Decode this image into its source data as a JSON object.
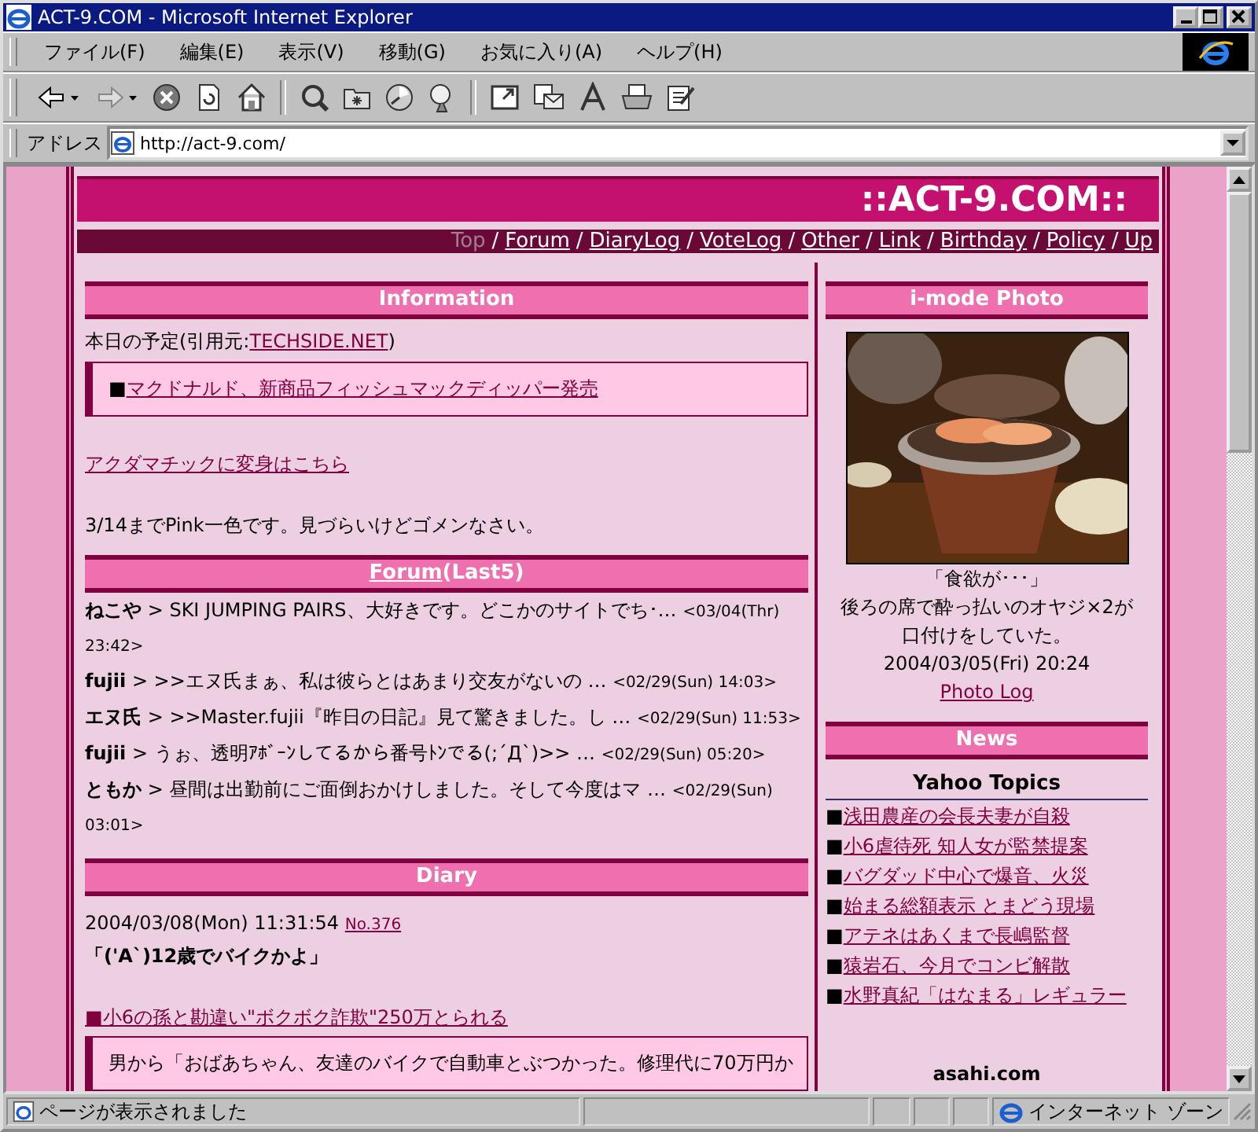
{
  "window": {
    "title": "ACT-9.COM - Microsoft Internet Explorer"
  },
  "menu": [
    "ファイル(F)",
    "編集(E)",
    "表示(V)",
    "移動(G)",
    "お気に入り(A)",
    "ヘルプ(H)"
  ],
  "address": {
    "label": "アドレス",
    "value": "http://act-9.com/"
  },
  "site": {
    "title": "::ACT-9.COM::",
    "nav_separator": "/",
    "nav": [
      {
        "label": "Top",
        "selected": true
      },
      {
        "label": "Forum",
        "selected": false
      },
      {
        "label": "DiaryLog",
        "selected": false
      },
      {
        "label": "VoteLog",
        "selected": false
      },
      {
        "label": "Other",
        "selected": false
      },
      {
        "label": "Link",
        "selected": false
      },
      {
        "label": "Birthday",
        "selected": false
      },
      {
        "label": "Policy",
        "selected": false
      },
      {
        "label": "Up",
        "selected": false
      }
    ],
    "information": {
      "heading": "Information",
      "source_prefix": "本日の予定(引用元:",
      "source_link": "TECHSIDE.NET",
      "source_suffix": ")",
      "headline_mark": "■",
      "headline": "マクドナルド、新商品フィッシュマックディッパー発売",
      "transform_link": "アクダマチックに変身はこちら",
      "notice": "3/14までPink一色です。見づらいけどゴメンなさい。"
    },
    "forum": {
      "heading_link": "Forum",
      "heading_rest": "(Last5)",
      "posts": [
        {
          "name": "ねこや",
          "text": "> SKI JUMPING PAIRS、大好きです。どこかのサイトでち･…",
          "date": "<03/04(Thr) 23:42>"
        },
        {
          "name": "fujii",
          "text": "> >>エヌ氏まぁ、私は彼らとはあまり交友がないの …",
          "date": "<02/29(Sun) 14:03>"
        },
        {
          "name": "エヌ氏",
          "text": "> >>Master.fujii『昨日の日記』見て驚きました。し …",
          "date": "<02/29(Sun) 11:53>"
        },
        {
          "name": "fujii",
          "text": "> うぉ、透明ｱﾎﾞｰﾝしてるから番号ﾄﾝでる(;´Д`)>> …",
          "date": "<02/29(Sun) 05:20>"
        },
        {
          "name": "ともか",
          "text": "> 昼間は出勤前にご面倒おかけしました。そして今度はマ …",
          "date": "<02/29(Sun) 03:01>"
        }
      ]
    },
    "diary": {
      "heading": "Diary",
      "datetime": "2004/03/08(Mon) 11:31:54",
      "number": "No.376",
      "title": "「('A`)12歳でバイクかよ」",
      "article_link": "■小6の孫と勘違い\"ボクボク詐欺\"250万とられる",
      "quote": "男から「おばあちゃん、友達のバイクで自動車とぶつかった。修理代に70万円か"
    },
    "photo": {
      "heading": "i-mode Photo",
      "kind": "picture",
      "caption_title": "「食欲が･･･」",
      "caption": "後ろの席で酔っ払いのオヤジ×2が口付けをしていた。",
      "date": "2004/03/05(Fri) 20:24",
      "log_link": "Photo Log"
    },
    "news": {
      "heading": "News",
      "source": "Yahoo Topics",
      "item_mark": "■",
      "items": [
        "浅田農産の会長夫妻が自殺",
        "小6虐待死 知人女が監禁提案",
        "バグダッド中心で爆音、火災",
        "始まる総額表示 とまどう現場",
        "アテネはあくまで長嶋監督",
        "猿岩石、今月でコンビ解散",
        "水野真紀「はなまる」レギュラー"
      ],
      "next_source": "asahi.com"
    }
  },
  "status_bar": {
    "message": "ページが表示されました",
    "zone": "インターネット ゾーン"
  }
}
